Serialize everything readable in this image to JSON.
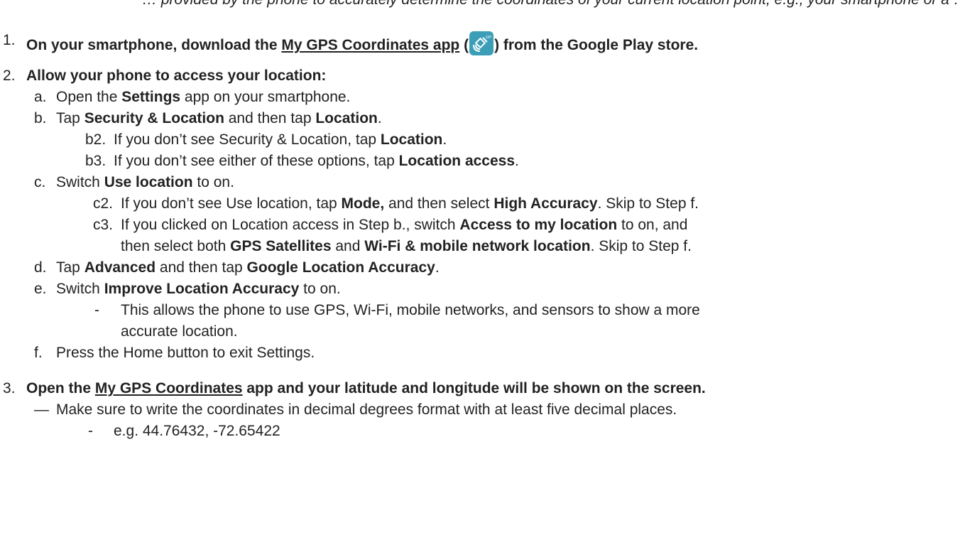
{
  "top_cut_text": "…  provided by the phone to accurately determine the coordinates of your current location point, e.g., your smartphone or a …",
  "step1": {
    "num": "1.",
    "text_a": "On your smartphone, download the ",
    "link": "My GPS Coordinates app",
    "text_b": " (",
    "text_c": ") from the Google Play store.",
    "icon": "gps-satellite-icon",
    "icon_color": "#3b9eb6"
  },
  "step2": {
    "num": "2.",
    "title": "Allow your phone to access your location:",
    "a": {
      "marker": "a.",
      "t1": "Open the ",
      "b1": "Settings",
      "t2": " app on your smartphone."
    },
    "b": {
      "marker": "b.",
      "t1": "Tap ",
      "b1": "Security & Location",
      "t2": " and then tap ",
      "b2": "Location",
      "t3": "."
    },
    "b2": {
      "marker": "b2.",
      "t1": "If you don’t see Security & Location, tap ",
      "b1": "Location",
      "t2": "."
    },
    "b3": {
      "marker": "b3.",
      "t1": "If you don’t see either of these options, tap ",
      "b1": "Location access",
      "t2": "."
    },
    "c": {
      "marker": "c.",
      "t1": "Switch ",
      "b1": "Use location",
      "t2": " to on."
    },
    "c2": {
      "marker": "c2.",
      "t1": "If you don’t see Use location, tap ",
      "b1": "Mode,",
      "t2": " and then select ",
      "b2": "High Accuracy",
      "t3": ". Skip to Step f."
    },
    "c3": {
      "marker": "c3.",
      "t1": "If you clicked on Location access in Step b., switch ",
      "b1": "Access to my location",
      "t2": " to on, and"
    },
    "c3_cont": {
      "t1": "then select both ",
      "b1": "GPS Satellites",
      "t2": " and ",
      "b2": "Wi-Fi & mobile network location",
      "t3": ". Skip to Step f."
    },
    "d": {
      "marker": "d.",
      "t1": "Tap ",
      "b1": "Advanced",
      "t2": " and then tap ",
      "b2": "Google Location Accuracy",
      "t3": "."
    },
    "e": {
      "marker": "e.",
      "t1": "Switch ",
      "b1": "Improve Location Accuracy",
      "t2": " to on."
    },
    "e_note": {
      "marker": "-",
      "t1": "This allows the phone to use GPS, Wi-Fi, mobile networks, and sensors to show a more"
    },
    "e_note_cont": {
      "t1": "accurate location."
    },
    "f": {
      "marker": "f.",
      "t1": "Press the Home button to exit Settings."
    }
  },
  "step3": {
    "num": "3.",
    "text_a": "Open the ",
    "link": "My GPS Coordinates",
    "text_b": " app and your latitude and longitude will be shown on the screen.",
    "note": {
      "marker": "—",
      "t1": "Make sure to write the coordinates in decimal degrees format with at least five decimal places."
    },
    "example": {
      "marker": "-",
      "t1": "e.g. 44.76432, -72.65422"
    }
  }
}
